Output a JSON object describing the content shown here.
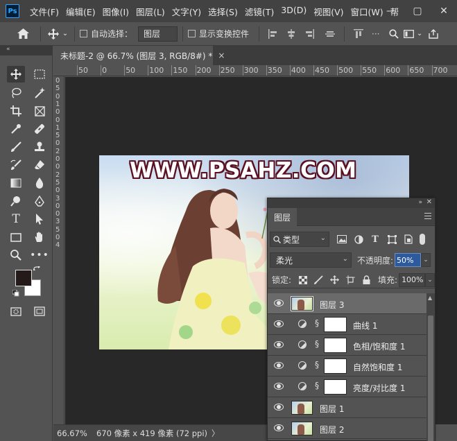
{
  "app": {
    "logo": "Ps",
    "menu": [
      "文件(F)",
      "编辑(E)",
      "图像(I)",
      "图层(L)",
      "文字(Y)",
      "选择(S)",
      "滤镜(T)",
      "3D(D)",
      "视图(V)",
      "窗口(W)",
      "帮"
    ],
    "window_controls": {
      "minimize": "—",
      "restore": "▢",
      "close": "✕"
    }
  },
  "options": {
    "auto_select_label": "自动选择：",
    "auto_select_target": "图层",
    "show_transform_label": "显示变换控件"
  },
  "toolbar": {
    "collapse": "«",
    "foreground_color": "#241a1a",
    "background_color": "#ffffff"
  },
  "document": {
    "tab_title": "未标题-2 @ 66.7% (图层 3, RGB/8#) *",
    "tab_close": "×",
    "ruler_top": [
      "50",
      "0",
      "50",
      "100",
      "150",
      "200",
      "250",
      "300",
      "350",
      "400",
      "450",
      "500",
      "550",
      "600",
      "650",
      "700"
    ],
    "ruler_left": [
      "0",
      "5",
      "0",
      "1",
      "0",
      "0",
      "1",
      "5",
      "0",
      "2",
      "0",
      "0",
      "2",
      "5",
      "0",
      "3",
      "0",
      "0",
      "3",
      "5",
      "0",
      "4"
    ],
    "watermark": "WWW.PSAHZ.COM"
  },
  "status": {
    "zoom": "66.67%",
    "doc_size": "670 像素 x 419 像素 (72 ppi)",
    "arrow": "〉"
  },
  "layers_panel": {
    "collapse": "»",
    "close": "✕",
    "tab": "图层",
    "filter_kind": "类型",
    "blend_mode": "柔光",
    "opacity_label": "不透明度:",
    "opacity_value": "50%",
    "lock_label": "锁定:",
    "fill_label": "填充:",
    "fill_value": "100%",
    "layers": [
      {
        "name": "图层 3",
        "type": "image",
        "selected": true
      },
      {
        "name": "曲线 1",
        "type": "adjustment",
        "selected": false
      },
      {
        "name": "色相/饱和度 1",
        "type": "adjustment",
        "selected": false
      },
      {
        "name": "自然饱和度 1",
        "type": "adjustment",
        "selected": false
      },
      {
        "name": "亮度/对比度 1",
        "type": "adjustment",
        "selected": false
      },
      {
        "name": "图层 1",
        "type": "image",
        "selected": false
      },
      {
        "name": "图层 2",
        "type": "image",
        "selected": false
      }
    ]
  }
}
